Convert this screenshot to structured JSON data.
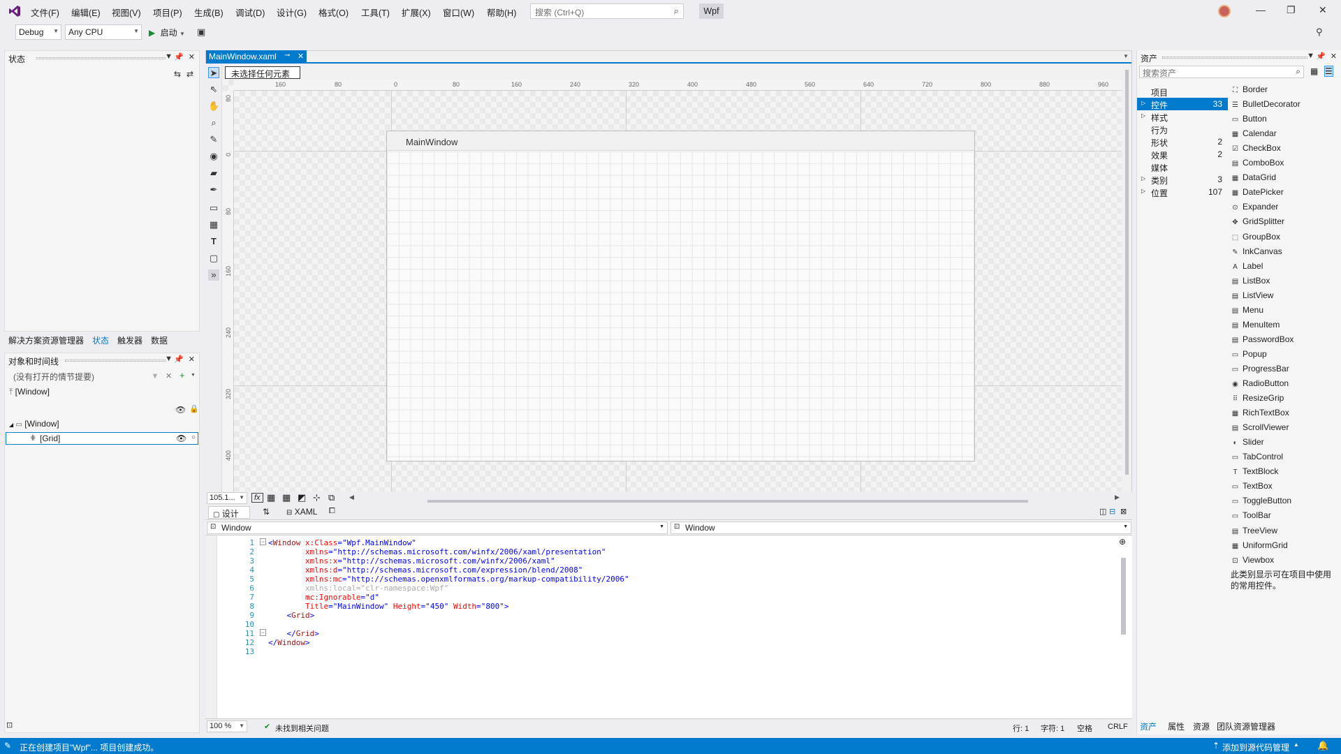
{
  "menu": [
    "文件(F)",
    "编辑(E)",
    "视图(V)",
    "项目(P)",
    "生成(B)",
    "调试(D)",
    "设计(G)",
    "格式(O)",
    "工具(T)",
    "扩展(X)",
    "窗口(W)",
    "帮助(H)"
  ],
  "search": {
    "placeholder": "搜索 (Ctrl+Q)"
  },
  "project_name": "Wpf",
  "toolbar": {
    "config": "Debug",
    "platform": "Any CPU",
    "start_label": "启动"
  },
  "states_panel": {
    "title": "状态"
  },
  "left_tabs": [
    "解决方案资源管理器",
    "状态",
    "触发器",
    "数据"
  ],
  "objects_panel": {
    "title": "对象和时间线",
    "storyboard_placeholder": "(没有打开的情节提要)",
    "root_item": "[Window]",
    "tree": [
      "[Window]",
      "[Grid]"
    ]
  },
  "document_tab": {
    "title": "MainWindow.xaml"
  },
  "designer": {
    "selection_label": "未选择任何元素",
    "ruler_h": [
      "160",
      "80",
      "0",
      "80",
      "160",
      "240",
      "320",
      "400",
      "480",
      "560",
      "640",
      "720",
      "800",
      "880",
      "960"
    ],
    "ruler_v": [
      "80",
      "0",
      "80",
      "160",
      "240",
      "320",
      "400"
    ],
    "window_title": "MainWindow",
    "zoom": "105.1..."
  },
  "split": {
    "design_label": "设计",
    "xaml_label": "XAML"
  },
  "xaml_nav": {
    "left": "Window",
    "right": "Window"
  },
  "code_lines": [
    {
      "n": "1",
      "text": "<Window x:Class=\"Wpf.MainWindow\""
    },
    {
      "n": "2",
      "text": "        xmlns=\"http://schemas.microsoft.com/winfx/2006/xaml/presentation\""
    },
    {
      "n": "3",
      "text": "        xmlns:x=\"http://schemas.microsoft.com/winfx/2006/xaml\""
    },
    {
      "n": "4",
      "text": "        xmlns:d=\"http://schemas.microsoft.com/expression/blend/2008\""
    },
    {
      "n": "5",
      "text": "        xmlns:mc=\"http://schemas.openxmlformats.org/markup-compatibility/2006\""
    },
    {
      "n": "6",
      "text": "        xmlns:local=\"clr-namespace:Wpf\""
    },
    {
      "n": "7",
      "text": "        mc:Ignorable=\"d\""
    },
    {
      "n": "8",
      "text": "        Title=\"MainWindow\" Height=\"450\" Width=\"800\">"
    },
    {
      "n": "9",
      "text": "    <Grid>"
    },
    {
      "n": "10",
      "text": ""
    },
    {
      "n": "11",
      "text": "    </Grid>"
    },
    {
      "n": "12",
      "text": "</Window>"
    },
    {
      "n": "13",
      "text": ""
    }
  ],
  "editor_status": {
    "zoom": "100 %",
    "issues": "未找到相关问题",
    "row": "行: 1",
    "col": "字符: 1",
    "space": "空格",
    "eol": "CRLF"
  },
  "assets": {
    "title": "资产",
    "search_placeholder": "搜索资产",
    "categories": [
      {
        "label": "项目",
        "count": ""
      },
      {
        "label": "控件",
        "count": "33"
      },
      {
        "label": "样式",
        "count": ""
      },
      {
        "label": "行为",
        "count": ""
      },
      {
        "label": "形状",
        "count": "2"
      },
      {
        "label": "效果",
        "count": "2"
      },
      {
        "label": "媒体",
        "count": ""
      },
      {
        "label": "类别",
        "count": "3"
      },
      {
        "label": "位置",
        "count": "107"
      }
    ],
    "controls": [
      "Border",
      "BulletDecorator",
      "Button",
      "Calendar",
      "CheckBox",
      "ComboBox",
      "DataGrid",
      "DatePicker",
      "Expander",
      "GridSplitter",
      "GroupBox",
      "InkCanvas",
      "Label",
      "ListBox",
      "ListView",
      "Menu",
      "MenuItem",
      "PasswordBox",
      "Popup",
      "ProgressBar",
      "RadioButton",
      "ResizeGrip",
      "RichTextBox",
      "ScrollViewer",
      "Slider",
      "TabControl",
      "TextBlock",
      "TextBox",
      "ToggleButton",
      "ToolBar",
      "TreeView",
      "UniformGrid",
      "Viewbox"
    ],
    "note": "此类别显示可在项目中使用的常用控件。",
    "bottom_tabs": [
      "资产",
      "属性",
      "资源",
      "团队资源管理器"
    ]
  },
  "statusbar": {
    "message": "正在创建项目\"Wpf\"... 项目创建成功。",
    "source_control": "添加到源代码管理"
  },
  "colors": {
    "accent": "#007acc",
    "tag": "#a31515",
    "attr": "#ff0000",
    "value": "#0000ff"
  }
}
